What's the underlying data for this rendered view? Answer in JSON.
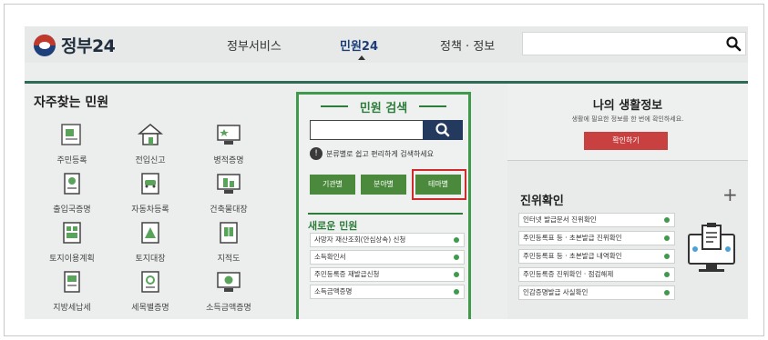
{
  "header": {
    "logo_text": "정부24",
    "nav": [
      "정부서비스",
      "민원24",
      "정책 · 정보"
    ],
    "search_placeholder": ""
  },
  "favorites": {
    "title": "자주찾는 민원",
    "items": [
      {
        "label": "주민등록",
        "icon": "id-card-icon"
      },
      {
        "label": "전입신고",
        "icon": "house-move-icon"
      },
      {
        "label": "병적증명",
        "icon": "military-record-icon"
      },
      {
        "label": "출입국증명",
        "icon": "passport-icon"
      },
      {
        "label": "자동차등록",
        "icon": "car-document-icon"
      },
      {
        "label": "건축물대장",
        "icon": "building-icon"
      },
      {
        "label": "토지이용계획",
        "icon": "land-use-icon"
      },
      {
        "label": "토지대장",
        "icon": "land-register-icon"
      },
      {
        "label": "지적도",
        "icon": "cadastral-map-icon"
      },
      {
        "label": "지방세납세",
        "icon": "tax-icon"
      },
      {
        "label": "세목별증명",
        "icon": "tax-certificate-icon"
      },
      {
        "label": "소득금액증명",
        "icon": "income-certificate-icon"
      }
    ]
  },
  "civil_search": {
    "title": "민원 검색",
    "input_value": "",
    "hint": "분류별로 쉽고 편리하게 검색하세요",
    "categories": [
      "기관별",
      "분야별",
      "테마별"
    ],
    "new_title": "새로운 민원",
    "new_items": [
      "사망자 재산조회(안심상속) 신청",
      "소득확인서",
      "주민등록증 재발급신청",
      "소득금액증명"
    ]
  },
  "life_info": {
    "title": "나의 생활정보",
    "subtitle": "생활에 필요한 정보를 한 번에 확인하세요.",
    "button": "확인하기"
  },
  "verify": {
    "title": "진위확인",
    "plus": "+",
    "items": [
      "인터넷 발급문서 진위확인",
      "주민등록표 등 · 초본발급 진위확인",
      "주민등록표 등 · 초본발급 내역확인",
      "주민등록증 진위확인 · 점검해제",
      "인감증명발급 사실확인"
    ]
  },
  "colors": {
    "accent_green": "#3f9a4b",
    "search_navy": "#233a5e",
    "highlight_red": "#d12a2a",
    "confirm_red": "#c94040"
  }
}
